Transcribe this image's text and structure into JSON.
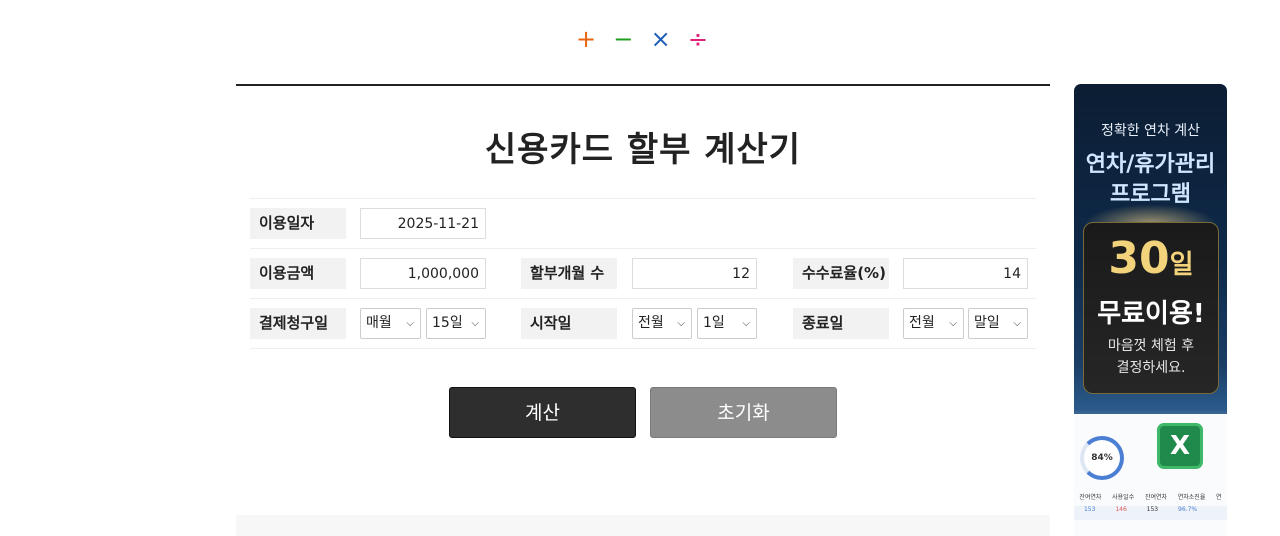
{
  "logo": {
    "symbols": [
      "+",
      "−",
      "×",
      "÷"
    ],
    "colors": [
      "#e8620f",
      "#1f9e1f",
      "#1f5fb8",
      "#e0207a"
    ]
  },
  "page": {
    "title": "신용카드 할부 계산기"
  },
  "form": {
    "use_date": {
      "label": "이용일자",
      "value": "2025-11-21"
    },
    "amount": {
      "label": "이용금액",
      "value": "1,000,000"
    },
    "months": {
      "label": "할부개월 수",
      "value": "12"
    },
    "fee_rate": {
      "label": "수수료율(%)",
      "value": "14"
    },
    "billing_day": {
      "label": "결제청구일",
      "period": "매월",
      "day": "15일"
    },
    "start_day": {
      "label": "시작일",
      "period": "전월",
      "day": "1일"
    },
    "end_day": {
      "label": "종료일",
      "period": "전월",
      "day": "말일"
    }
  },
  "buttons": {
    "calculate": "계산",
    "reset": "초기화"
  },
  "ad": {
    "subtitle": "정확한 연차 계산",
    "headline_1": "연차/휴가관리",
    "headline_2": "프로그램",
    "big_number": "30",
    "big_unit": "일",
    "free": "무료이용!",
    "note_1": "마음껏 체험 후",
    "note_2": "결정하세요.",
    "excel_letter": "X",
    "ring_value": "84%",
    "table_header": [
      "잔여연차",
      "사용일수",
      "잔여연차",
      "연차소진율",
      "연"
    ],
    "table_values": [
      "153",
      "146",
      "153",
      "96.7%",
      ""
    ]
  }
}
